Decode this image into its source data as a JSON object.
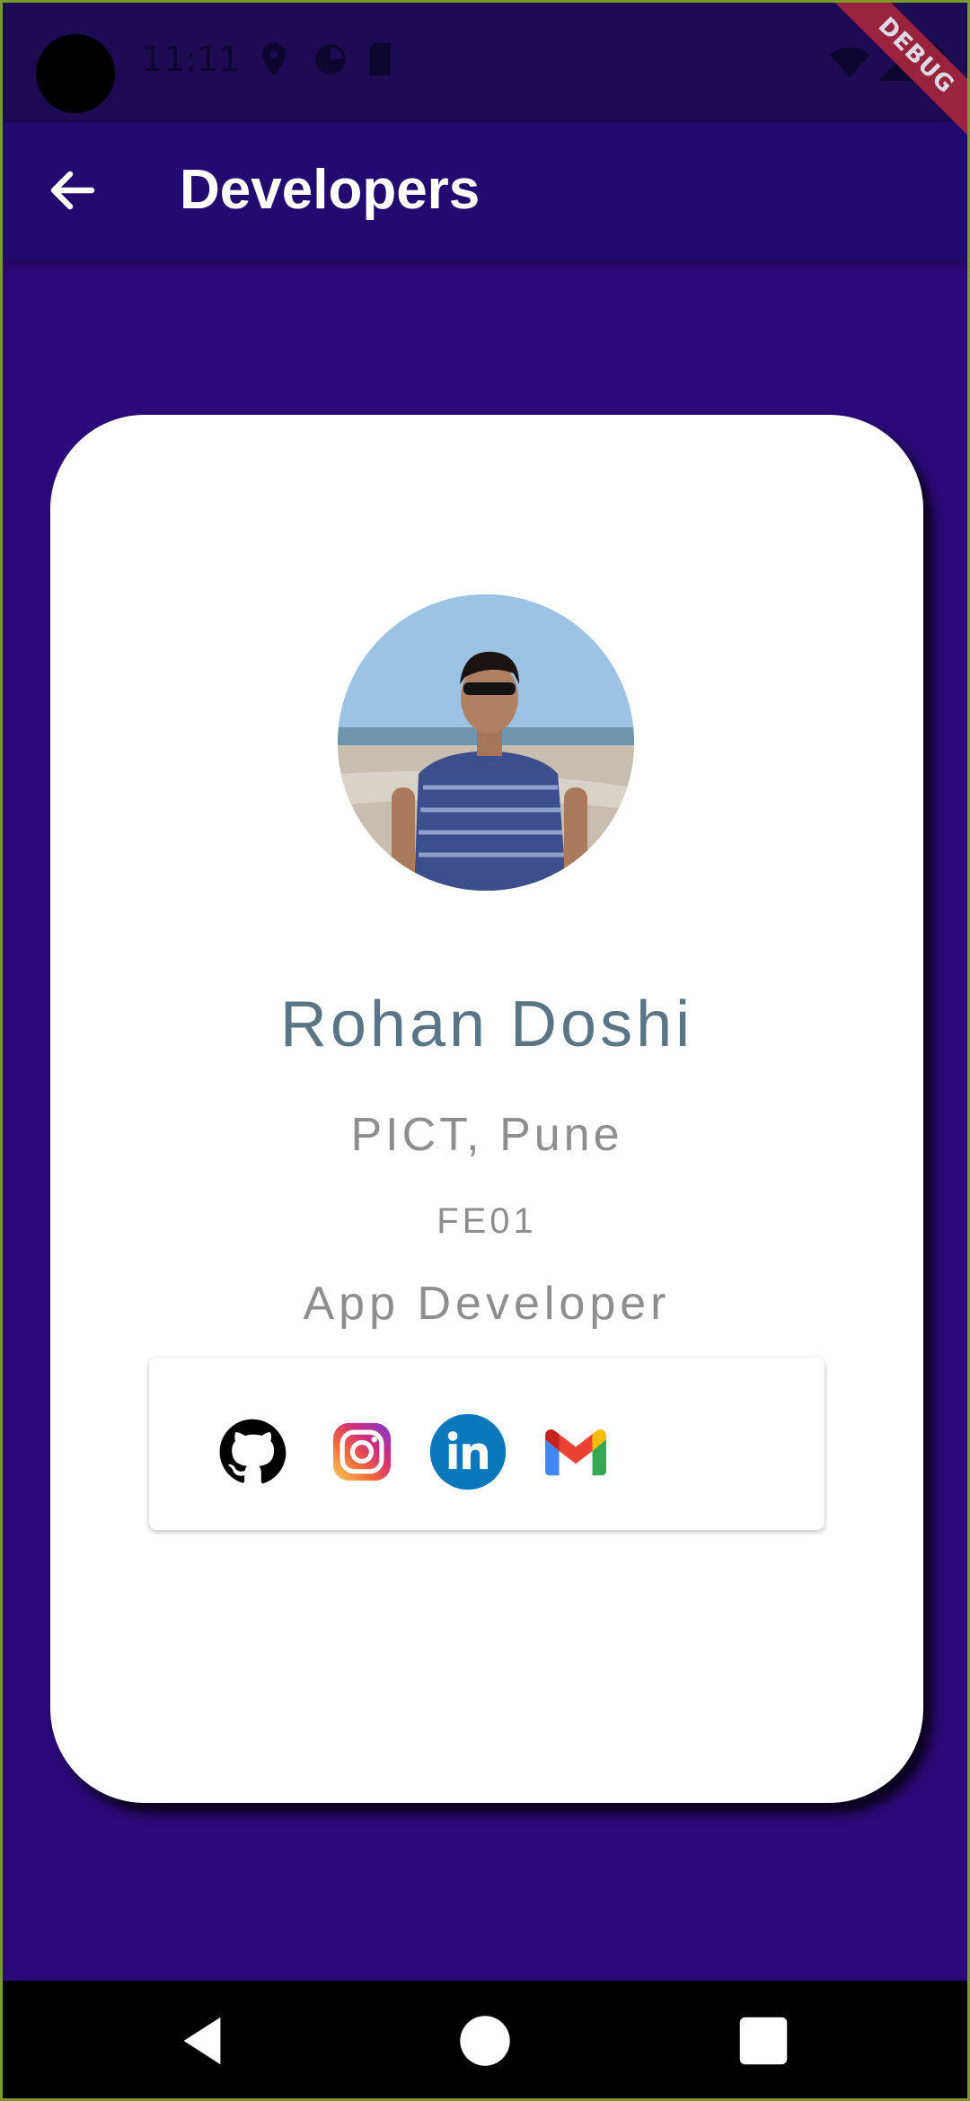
{
  "status_bar": {
    "time": "11:11"
  },
  "debug_banner": {
    "label": "DEBUG"
  },
  "app_bar": {
    "title": "Developers"
  },
  "profile": {
    "name": "Rohan Doshi",
    "college": "PICT, Pune",
    "code": "FE01",
    "role": "App Developer"
  },
  "social_links": [
    {
      "icon": "github-icon"
    },
    {
      "icon": "instagram-icon"
    },
    {
      "icon": "linkedin-icon"
    },
    {
      "icon": "gmail-icon"
    }
  ],
  "colors": {
    "background": "#2a0a78",
    "app_bar": "#220b70",
    "name_text": "#5a7586",
    "secondary_text": "#8e8e8e"
  }
}
